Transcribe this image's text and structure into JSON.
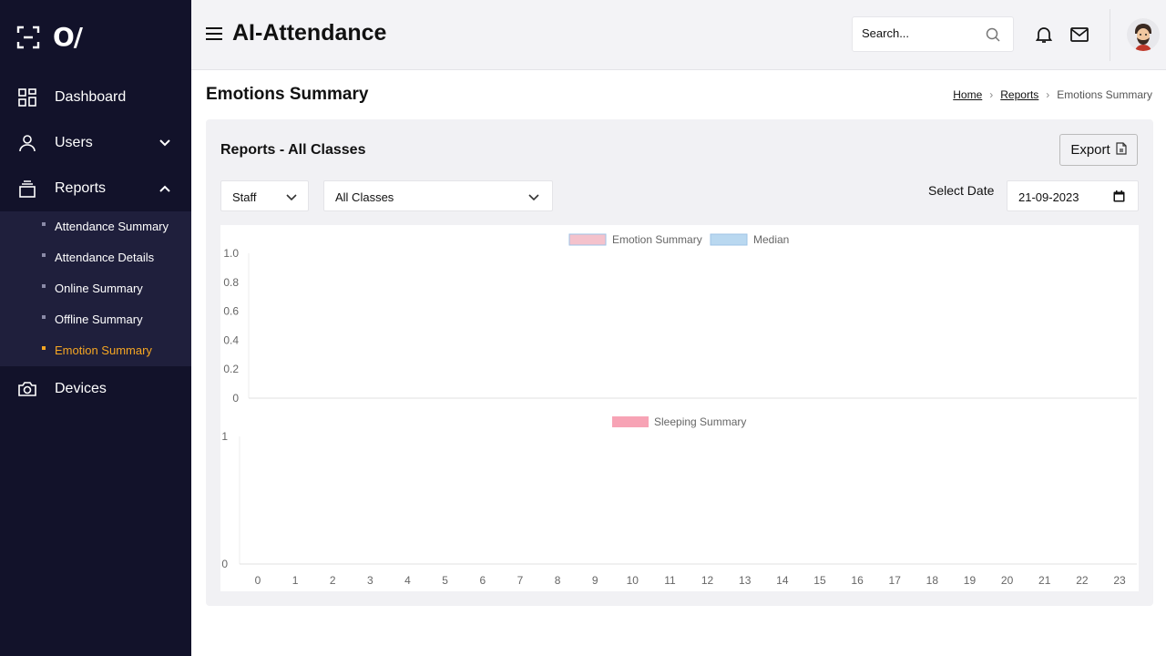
{
  "sidebar": {
    "logo_text": "O/",
    "items": [
      {
        "label": "Dashboard",
        "icon": "grid-icon"
      },
      {
        "label": "Users",
        "icon": "user-icon"
      },
      {
        "label": "Reports",
        "icon": "stack-icon"
      },
      {
        "label": "Devices",
        "icon": "camera-icon"
      }
    ],
    "reports_sub": [
      {
        "label": "Attendance Summary"
      },
      {
        "label": "Attendance Details"
      },
      {
        "label": "Online Summary"
      },
      {
        "label": "Offline Summary"
      },
      {
        "label": "Emotion Summary"
      }
    ],
    "accent": "#f5a623",
    "bg": "#12122a"
  },
  "header": {
    "title": "AI-Attendance",
    "search_placeholder": "Search..."
  },
  "page": {
    "title": "Emotions Summary",
    "breadcrumb": [
      "Home",
      "Reports",
      "Emotions Summary"
    ]
  },
  "card": {
    "title": "Reports - All Classes",
    "export_label": "Export",
    "filter_type": "Staff",
    "filter_class": "All Classes",
    "date_label": "Select Date",
    "date_value": "21-09-2023"
  },
  "chart_data": [
    {
      "type": "bar",
      "series": [
        {
          "name": "Emotion Summary",
          "values": [],
          "color": "#f4c2cc"
        },
        {
          "name": "Median",
          "values": [],
          "color": "#b9d8f0"
        }
      ],
      "yticks": [
        "0",
        "0.2",
        "0.4",
        "0.6",
        "0.8",
        "1.0"
      ],
      "ylim": [
        0,
        1.0
      ],
      "legend": "top-center"
    },
    {
      "type": "bar",
      "series": [
        {
          "name": "Sleeping Summary",
          "values": [],
          "color": "#f7a3b5"
        }
      ],
      "yticks": [
        "0",
        "1"
      ],
      "ylim": [
        0,
        1
      ],
      "categories": [
        "0",
        "1",
        "2",
        "3",
        "4",
        "5",
        "6",
        "7",
        "8",
        "9",
        "10",
        "11",
        "12",
        "13",
        "14",
        "15",
        "16",
        "17",
        "18",
        "19",
        "20",
        "21",
        "22",
        "23"
      ],
      "legend": "top-center"
    }
  ]
}
